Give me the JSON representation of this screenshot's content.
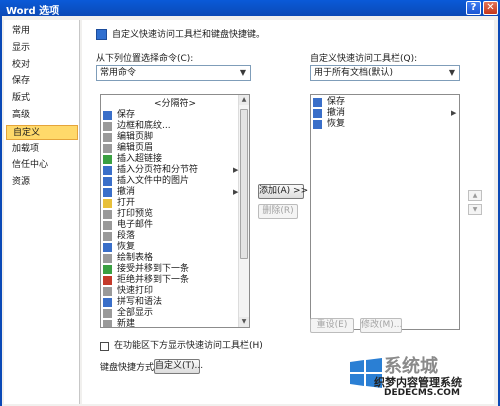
{
  "window": {
    "title": "Word 选项",
    "help_glyph": "?",
    "close_glyph": "✕"
  },
  "sidebar": {
    "items": [
      {
        "label": "常用"
      },
      {
        "label": "显示"
      },
      {
        "label": "校对"
      },
      {
        "label": "保存"
      },
      {
        "label": "版式"
      },
      {
        "label": "高级"
      },
      {
        "label": "自定义",
        "active": true
      },
      {
        "label": "加载项"
      },
      {
        "label": "信任中心"
      },
      {
        "label": "资源"
      }
    ]
  },
  "main": {
    "header": "自定义快速访问工具栏和键盘快捷键。",
    "left_label": "从下列位置选择命令(C):",
    "left_dropdown_value": "常用命令",
    "right_label": "自定义快速访问工具栏(Q):",
    "right_dropdown_value": "用于所有文档(默认)",
    "commands": [
      {
        "label": "<分隔符>",
        "sep": true
      },
      {
        "label": "保存",
        "icon": "save-icon",
        "color": "ri-blue"
      },
      {
        "label": "边框和底纹...",
        "icon": "borders-icon",
        "color": "ri-gray"
      },
      {
        "label": "编辑页脚",
        "icon": "footer-icon",
        "color": "ri-gray"
      },
      {
        "label": "编辑页眉",
        "icon": "header-icon",
        "color": "ri-gray"
      },
      {
        "label": "插入超链接",
        "icon": "hyperlink-icon",
        "color": "ri-green"
      },
      {
        "label": "插入分页符和分节符",
        "icon": "page-break-icon",
        "color": "ri-blue",
        "submenu": true
      },
      {
        "label": "插入文件中的图片",
        "icon": "picture-icon",
        "color": "ri-blue"
      },
      {
        "label": "撤消",
        "icon": "undo-icon",
        "color": "ri-blue",
        "submenu": true
      },
      {
        "label": "打开",
        "icon": "open-folder-icon",
        "color": "ri-yellow"
      },
      {
        "label": "打印预览",
        "icon": "print-preview-icon",
        "color": "ri-gray"
      },
      {
        "label": "电子邮件",
        "icon": "email-icon",
        "color": "ri-gray"
      },
      {
        "label": "段落",
        "icon": "paragraph-icon",
        "color": "ri-gray"
      },
      {
        "label": "恢复",
        "icon": "redo-icon",
        "color": "ri-blue"
      },
      {
        "label": "绘制表格",
        "icon": "draw-table-icon",
        "color": "ri-gray"
      },
      {
        "label": "接受并移到下一条",
        "icon": "accept-change-icon",
        "color": "ri-green"
      },
      {
        "label": "拒绝并移到下一条",
        "icon": "reject-change-icon",
        "color": "ri-red"
      },
      {
        "label": "快速打印",
        "icon": "quick-print-icon",
        "color": "ri-gray"
      },
      {
        "label": "拼写和语法",
        "icon": "spelling-icon",
        "color": "ri-blue"
      },
      {
        "label": "全部显示",
        "icon": "show-all-icon",
        "color": "ri-gray"
      },
      {
        "label": "新建",
        "icon": "new-document-icon",
        "color": "ri-gray"
      }
    ],
    "toolbar_items": [
      {
        "label": "保存",
        "icon": "save-icon",
        "color": "ri-blue"
      },
      {
        "label": "撤消",
        "icon": "undo-icon",
        "color": "ri-blue",
        "submenu": true
      },
      {
        "label": "恢复",
        "icon": "redo-icon",
        "color": "ri-blue"
      }
    ],
    "add_button": "添加(A) >>",
    "remove_button": "删除(R)",
    "reset_button": "重设(E)",
    "modify_button": "修改(M)...",
    "checkbox_label": "在功能区下方显示快速访问工具栏(H)",
    "shortcut_label": "键盘快捷方式:",
    "customize_button": "自定义(T)...",
    "move_up_glyph": "▲",
    "move_down_glyph": "▼"
  },
  "watermark": {
    "big_text": "系统城",
    "line1": "织梦内容管理系统",
    "line2": "DEDECMS.COM"
  }
}
